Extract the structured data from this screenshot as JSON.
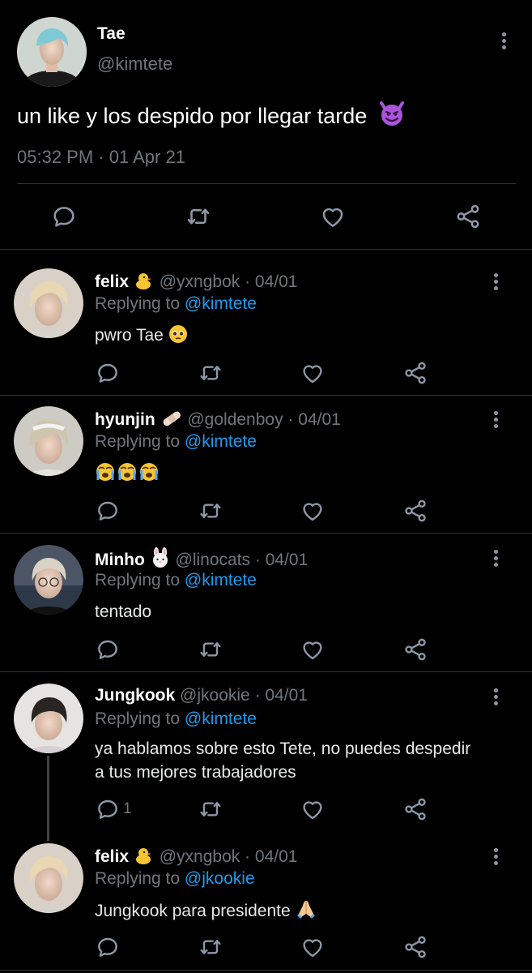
{
  "main_tweet": {
    "name": "Tae",
    "handle": "@kimtete",
    "text": "un like y los despido por llegar tarde",
    "emoji": "smiling-devil",
    "time": "05:32 PM",
    "dot": "·",
    "date": "01 Apr 21"
  },
  "replying_label": "Replying to",
  "replies": [
    {
      "name": "felix",
      "badge": "chick-emoji",
      "handle": "@yxngbok",
      "date": "· 04/01",
      "reply_to": "@kimtete",
      "text": "pwro Tae",
      "emoji": "pleading-face"
    },
    {
      "name": "hyunjin",
      "badge": "bandage-emoji",
      "handle": "@goldenboy",
      "date": "· 04/01",
      "reply_to": "@kimtete",
      "text": "",
      "emoji": "three-loudly-crying-faces"
    },
    {
      "name": "Minho",
      "badge": "rabbit-emoji",
      "handle": "@linocats",
      "date": "· 04/01",
      "reply_to": "@kimtete",
      "text": "tentado"
    },
    {
      "name": "Jungkook",
      "handle": "@jkookie",
      "date": "· 04/01",
      "reply_to": "@kimtete",
      "text": "ya hablamos sobre esto Tete, no puedes despedir a tus mejores trabajadores",
      "reply_count": "1"
    },
    {
      "name": "felix",
      "badge": "chick-emoji",
      "handle": "@yxngbok",
      "date": "· 04/01",
      "reply_to": "@jkookie",
      "text": "Jungkook para presidente",
      "emoji": "folded-hands"
    }
  ],
  "colors": {
    "background": "#000000",
    "link": "#1d9bf0",
    "muted": "#71767b",
    "separator": "#2f3336"
  }
}
